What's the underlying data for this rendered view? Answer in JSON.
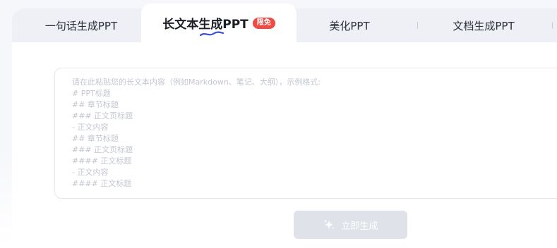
{
  "tabs": [
    {
      "label": "一句话生成PPT",
      "active": false
    },
    {
      "label": "长文本生成PPT",
      "active": true,
      "badge": "限免"
    },
    {
      "label": "美化PPT",
      "active": false
    },
    {
      "label": "文档生成PPT",
      "active": false
    }
  ],
  "editor": {
    "placeholder_lines": [
      "请在此粘贴您的长文本内容（例如Markdown、笔记、大纲），示例格式:",
      "# PPT标题",
      "## 章节标题",
      "### 正文页标题",
      "- 正文内容",
      "## 章节标题",
      "### 正文页标题",
      "#### 正文标题",
      "- 正文内容",
      "#### 正文标题"
    ]
  },
  "generate_button": {
    "label": "立即生成",
    "icon": "sparkle-icon",
    "disabled": true
  },
  "colors": {
    "badge": "#f04a45",
    "underline": "#3b4fd8",
    "button_disabled": "#dfe2e8",
    "placeholder_text": "#c3c7cf"
  }
}
